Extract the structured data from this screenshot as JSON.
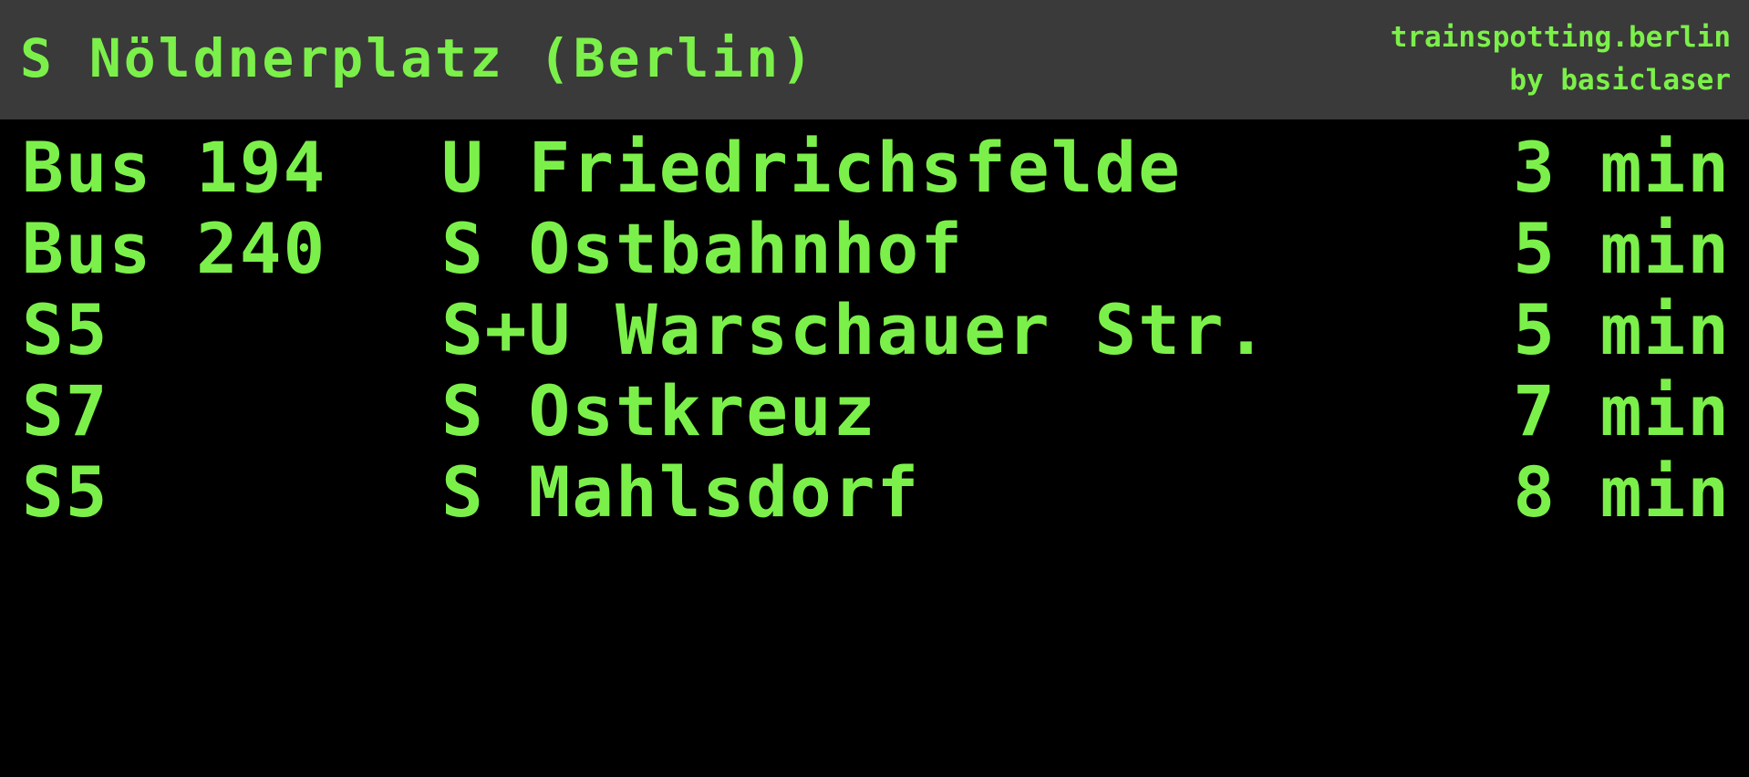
{
  "header": {
    "station": "S Nöldnerplatz (Berlin)",
    "site": "trainspotting.berlin",
    "author": "by basiclaser"
  },
  "colors": {
    "text": "#7cf04a",
    "header_bg": "#3a3a3a",
    "board_bg": "#000000"
  },
  "departures": [
    {
      "line": "Bus 194",
      "destination": "U Friedrichsfelde",
      "time": "3 min"
    },
    {
      "line": "Bus 240",
      "destination": "S Ostbahnhof",
      "time": "5 min"
    },
    {
      "line": "S5",
      "destination": "S+U Warschauer Str.",
      "time": "5 min"
    },
    {
      "line": "S7",
      "destination": "S Ostkreuz",
      "time": "7 min"
    },
    {
      "line": "S5",
      "destination": "S Mahlsdorf",
      "time": "8 min"
    }
  ]
}
